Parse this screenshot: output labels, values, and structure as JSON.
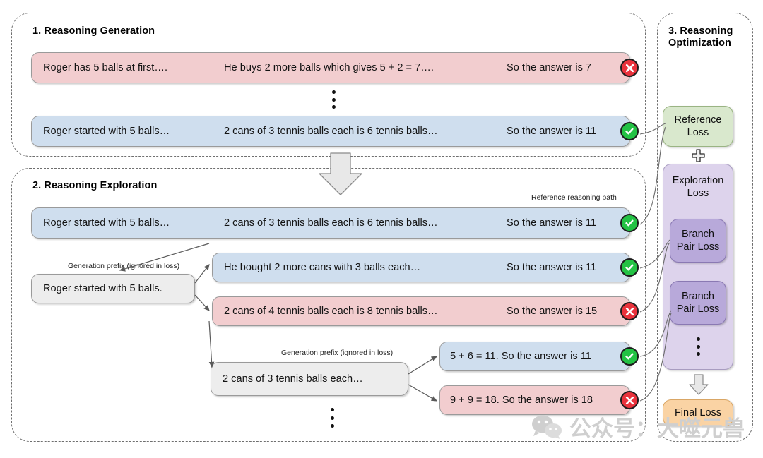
{
  "sections": {
    "s1": {
      "title": "1. Reasoning Generation"
    },
    "s2": {
      "title": "2. Reasoning Exploration"
    },
    "s3": {
      "title": "3. Reasoning\nOptimization"
    }
  },
  "captions": {
    "reference_path": "Reference reasoning path",
    "gen_prefix_1": "Generation prefix (ignored in loss)",
    "gen_prefix_2": "Generation prefix (ignored in loss)"
  },
  "generation_rows": [
    {
      "id": "gen-wrong",
      "color": "pink",
      "status": "incorrect",
      "seg1": "Roger has 5 balls at first….",
      "seg2": "He buys 2 more balls which gives 5 + 2 = 7….",
      "seg3": "So the answer is 7"
    },
    {
      "id": "gen-correct",
      "color": "blue",
      "status": "correct",
      "seg1": "Roger started with 5 balls…",
      "seg2": "2 cans of 3 tennis balls each is 6 tennis balls…",
      "seg3": "So the answer is 11"
    }
  ],
  "exploration": {
    "reference_row": {
      "id": "explore-reference",
      "color": "blue",
      "status": "correct",
      "seg1": "Roger started with 5 balls…",
      "seg2": "2 cans of 3 tennis balls each is 6 tennis balls…",
      "seg3": "So the answer is 11"
    },
    "prefix_1": {
      "id": "prefix-1",
      "color": "grey",
      "text": "Roger started with 5 balls."
    },
    "branches_1": [
      {
        "id": "branch-1a",
        "color": "blue",
        "status": "correct",
        "seg1": "He bought 2 more cans with 3 balls each…",
        "seg3": "So the answer is 11"
      },
      {
        "id": "branch-1b",
        "color": "pink",
        "status": "incorrect",
        "seg1": "2 cans of 4 tennis balls each is 8 tennis balls…",
        "seg3": "So the answer is 15"
      }
    ],
    "prefix_2": {
      "id": "prefix-2",
      "color": "grey",
      "text": "2 cans of 3 tennis balls each…"
    },
    "branches_2": [
      {
        "id": "branch-2a",
        "color": "blue",
        "status": "correct",
        "seg1": "5 + 6 = 11. So the answer is 11"
      },
      {
        "id": "branch-2b",
        "color": "pink",
        "status": "incorrect",
        "seg1": "9 + 9 = 18. So the answer is 18"
      }
    ]
  },
  "optimization": {
    "reference_loss": "Reference\nLoss",
    "plus": "+",
    "exploration_loss": "Exploration\nLoss",
    "branch_pair_loss_1": "Branch\nPair Loss",
    "branch_pair_loss_2": "Branch\nPair Loss",
    "final_loss": "Final Loss"
  },
  "status_glyphs": {
    "correct": "✔",
    "incorrect": "✕"
  },
  "colors": {
    "pink": "#f2cdcf",
    "blue": "#cfdeee",
    "grey": "#ededed",
    "green_badge": "#23c244",
    "red_badge": "#e9323c",
    "reference_loss": "#d9e8cd",
    "exploration_loss": "#ddd3ec",
    "branch_pair_loss": "#b8a9da",
    "final_loss": "#fad3a4"
  },
  "watermark": {
    "text": "公众号：大噬元兽",
    "icon": "wechat-icon"
  }
}
